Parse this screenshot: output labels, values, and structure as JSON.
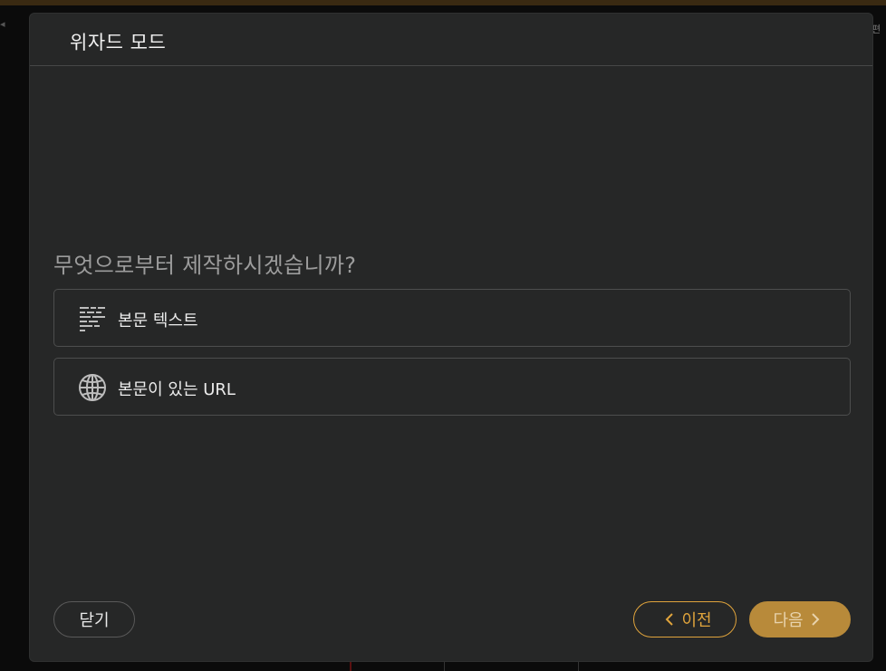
{
  "backdrop": {
    "left_glyph": "◂",
    "right_glyph": "편"
  },
  "dialog": {
    "title": "위자드 모드",
    "question": "무엇으로부터 제작하시겠습니까?",
    "options": [
      {
        "label": "본문 텍스트",
        "icon": "text-lines-icon"
      },
      {
        "label": "본문이 있는 URL",
        "icon": "globe-icon"
      }
    ],
    "buttons": {
      "close": "닫기",
      "prev": "이전",
      "next": "다음"
    }
  },
  "colors": {
    "dialog_bg": "#262727",
    "accent": "#e0a43c",
    "primary_btn": "#b88a3a",
    "muted_text": "#9c9c9c"
  }
}
